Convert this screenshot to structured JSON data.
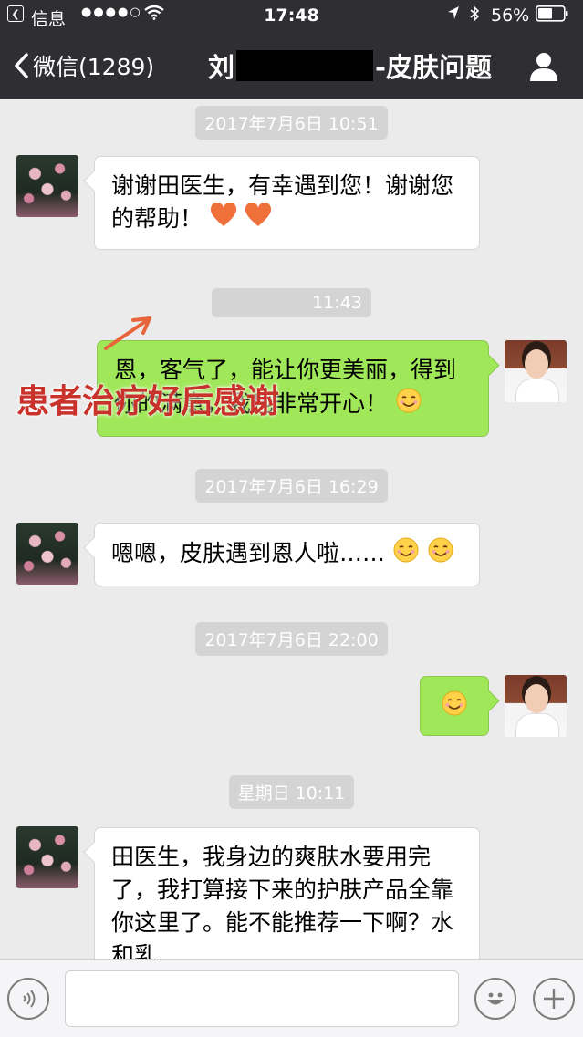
{
  "status_bar": {
    "back_app": "信息",
    "signal": "●●●●○",
    "time": "17:48",
    "battery": "56%"
  },
  "nav": {
    "back_label": "微信(1289)",
    "title_prefix": "刘",
    "title_suffix": "-皮肤问题"
  },
  "messages": [
    {
      "type": "timestamp",
      "text": "2017年7月6日 10:51"
    },
    {
      "type": "incoming",
      "text": "谢谢田医生，有幸遇到您！谢谢您的帮助！",
      "emoji": [
        "heart",
        "heart"
      ]
    },
    {
      "type": "timestamp",
      "text": "11:43"
    },
    {
      "type": "outgoing",
      "text": "恩，客气了，能让你更美丽，得到你的满意，我也非常开心！",
      "emoji": [
        "smile"
      ]
    },
    {
      "type": "timestamp",
      "text": "2017年7月6日 16:29"
    },
    {
      "type": "incoming",
      "text": "嗯嗯，皮肤遇到恩人啦……",
      "emoji": [
        "smile",
        "smile"
      ]
    },
    {
      "type": "timestamp",
      "text": "2017年7月6日 22:00"
    },
    {
      "type": "outgoing",
      "text": "",
      "emoji": [
        "smile"
      ]
    },
    {
      "type": "timestamp",
      "text": "星期日 10:11"
    },
    {
      "type": "incoming",
      "text": "田医生，我身边的爽肤水要用完了，我打算接下来的护肤产品全靠你这里了。能不能推荐一下啊？水和乳"
    }
  ],
  "annotation": {
    "text": "患者治疗好后感谢",
    "color": "#c8322a"
  },
  "colors": {
    "outgoing_bubble": "#a0e75a",
    "header": "#2e2e33",
    "chat_bg": "#ebebeb"
  },
  "input": {
    "value": "",
    "placeholder": ""
  }
}
